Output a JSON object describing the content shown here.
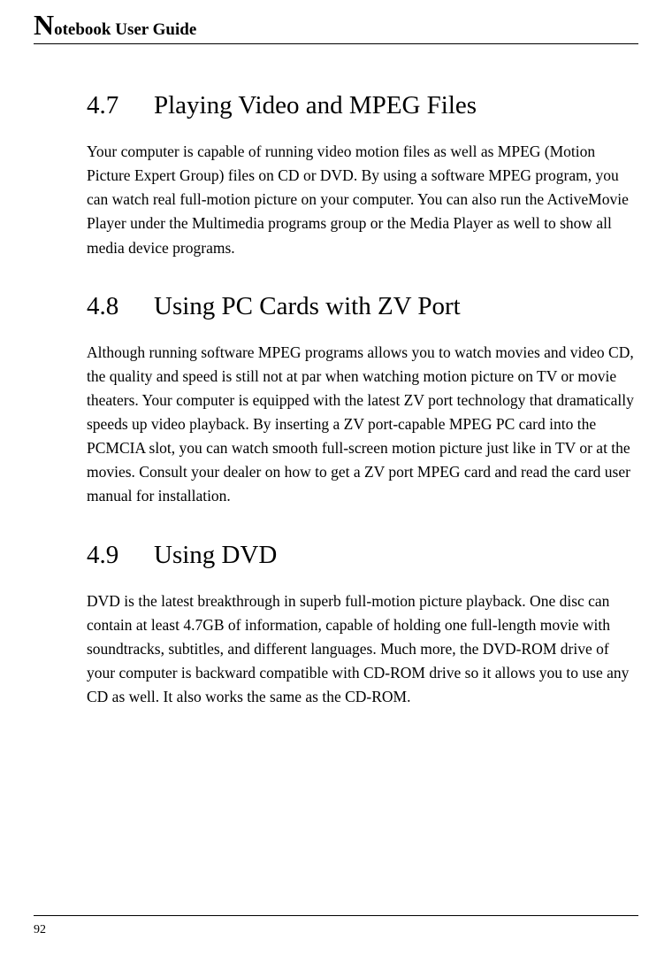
{
  "header": {
    "bigLetter": "N",
    "title": "otebook User Guide"
  },
  "sections": [
    {
      "number": "4.7",
      "title": "Playing Video and MPEG Files",
      "body": "Your computer is capable of running video motion files as well as MPEG (Motion Picture Expert Group) files on CD or DVD. By using a software MPEG program, you can watch real full-motion picture on your computer. You can also run the ActiveMovie Player under the Multimedia programs group or the Media Player as well to show all media device programs."
    },
    {
      "number": "4.8",
      "title": "Using PC Cards with ZV Port",
      "body": "Although running software MPEG programs allows you to watch movies and video CD, the quality and speed is still not at par when watching motion picture on TV or movie theaters. Your computer is equipped with the latest ZV port technology that dramatically speeds up video playback. By inserting a ZV port-capable MPEG PC card into the PCMCIA slot, you can watch smooth full-screen motion picture just like in TV or at the movies. Consult your dealer on how to get a ZV port MPEG card and read the card user manual for installation."
    },
    {
      "number": "4.9",
      "title": "Using DVD",
      "body": "DVD is the latest breakthrough in superb full-motion picture playback. One disc can contain at least 4.7GB of information, capable of holding one full-length movie with soundtracks, subtitles, and different languages. Much more, the DVD-ROM drive of your computer is backward compatible with CD-ROM drive so it allows you to use any CD as well. It also works the same as the CD-ROM."
    }
  ],
  "pageNumber": "92"
}
